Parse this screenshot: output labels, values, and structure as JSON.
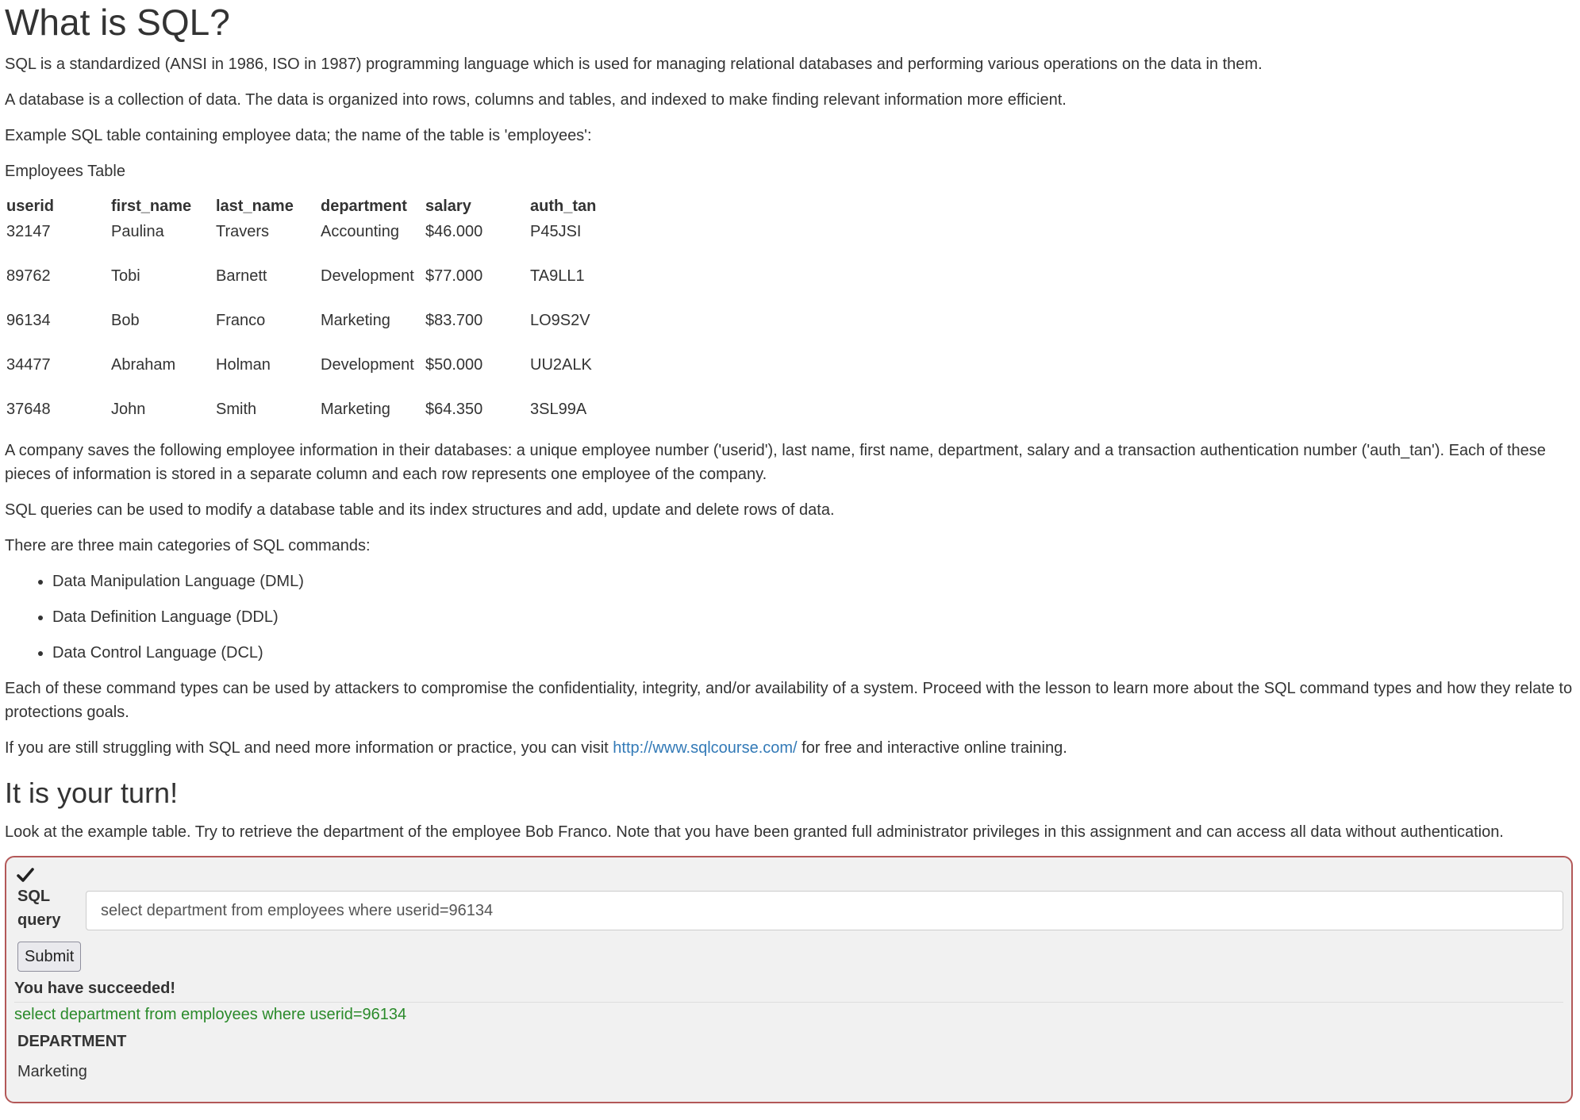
{
  "title": "What is SQL?",
  "intro": {
    "p1": "SQL is a standardized (ANSI in 1986, ISO in 1987) programming language which is used for managing relational databases and performing various operations on the data in them.",
    "p2": "A database is a collection of data. The data is organized into rows, columns and tables, and indexed to make finding relevant information more efficient.",
    "p3": "Example SQL table containing employee data; the name of the table is 'employees':"
  },
  "employees_table": {
    "caption": "Employees Table",
    "headers": [
      "userid",
      "first_name",
      "last_name",
      "department",
      "salary",
      "auth_tan"
    ],
    "rows": [
      [
        "32147",
        "Paulina",
        "Travers",
        "Accounting",
        "$46.000",
        "P45JSI"
      ],
      [
        "89762",
        "Tobi",
        "Barnett",
        "Development",
        "$77.000",
        "TA9LL1"
      ],
      [
        "96134",
        "Bob",
        "Franco",
        "Marketing",
        "$83.700",
        "LO9S2V"
      ],
      [
        "34477",
        "Abraham",
        "Holman",
        "Development",
        "$50.000",
        "UU2ALK"
      ],
      [
        "37648",
        "John",
        "Smith",
        "Marketing",
        "$64.350",
        "3SL99A"
      ]
    ]
  },
  "body": {
    "p4": "A company saves the following employee information in their databases: a unique employee number ('userid'), last name, first name, department, salary and a transaction authentication number ('auth_tan'). Each of these pieces of information is stored in a separate column and each row represents one employee of the company.",
    "p5": "SQL queries can be used to modify a database table and its index structures and add, update and delete rows of data.",
    "p6": "There are three main categories of SQL commands:",
    "categories": [
      "Data Manipulation Language (DML)",
      "Data Definition Language (DDL)",
      "Data Control Language (DCL)"
    ],
    "p7": "Each of these command types can be used by attackers to compromise the confidentiality, integrity, and/or availability of a system. Proceed with the lesson to learn more about the SQL command types and how they relate to protections goals.",
    "p8_before": "If you are still struggling with SQL and need more information or practice, you can visit ",
    "p8_link": "http://www.sqlcourse.com/",
    "p8_after": " for free and interactive online training."
  },
  "turn": {
    "heading": "It is your turn!",
    "instructions": "Look at the example table. Try to retrieve the department of the employee Bob Franco. Note that you have been granted full administrator privileges in this assignment and can access all data without authentication."
  },
  "assignment": {
    "status_icon": "check-icon",
    "query_label_line1": "SQL",
    "query_label_line2": "query",
    "query_value": "select department from employees where userid=96134",
    "submit_label": "Submit",
    "feedback": "You have succeeded!",
    "output_query": "select department from employees where userid=96134",
    "result_header": "DEPARTMENT",
    "result_value": "Marketing"
  },
  "colors": {
    "link": "#337ab7",
    "success_text": "#2a8a2a",
    "assignment_border": "#b35858",
    "assignment_bg": "#f1f1f1"
  }
}
